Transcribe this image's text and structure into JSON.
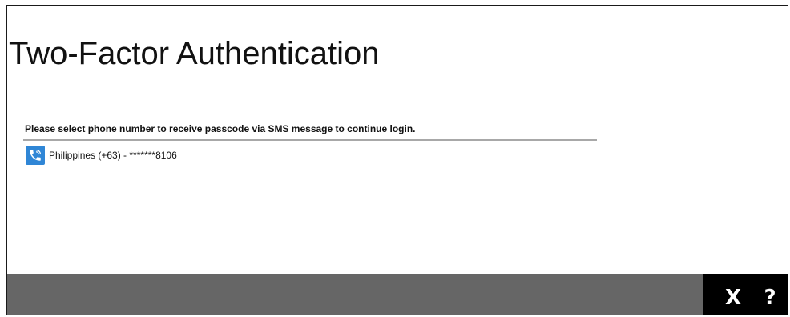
{
  "dialog": {
    "title": "Two-Factor Authentication",
    "instruction": "Please select phone number to receive passcode via SMS message to continue login.",
    "phones": [
      {
        "label": "Philippines (+63) - *******8106",
        "icon": "phone-icon"
      }
    ]
  },
  "footer": {
    "close_label": "X",
    "help_label": "?"
  },
  "colors": {
    "footer_bar": "#666666",
    "footer_actions": "#000000",
    "phone_icon_bg": "#2f86d6",
    "divider": "#a8a8a8"
  }
}
